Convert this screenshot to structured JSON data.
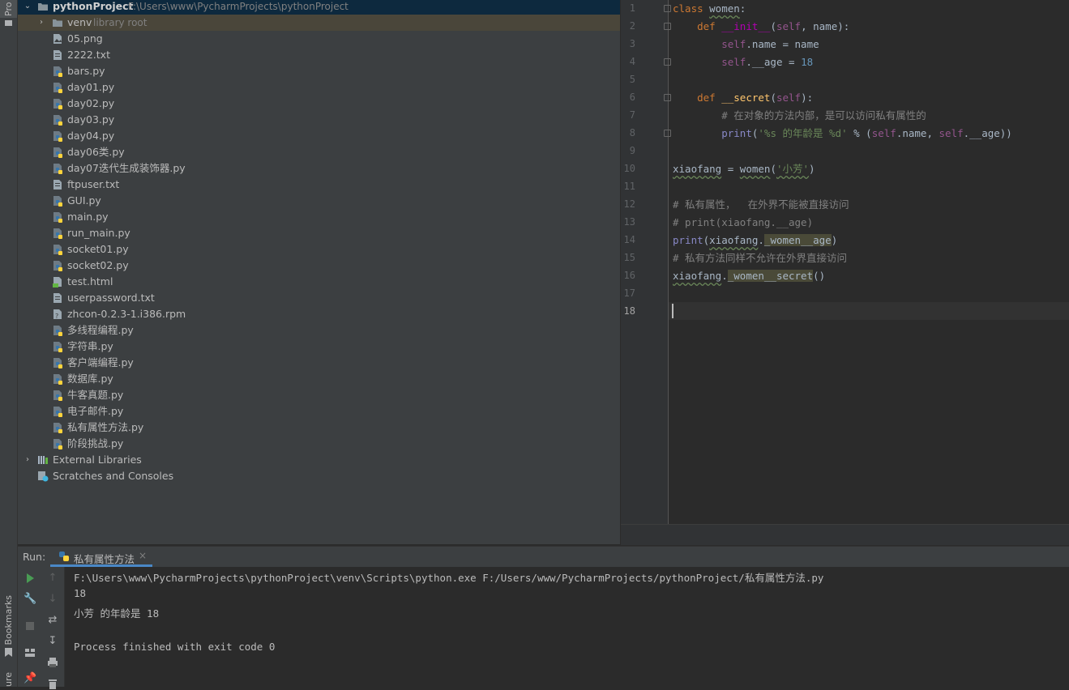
{
  "tool_stripe": {
    "project_tab": "Pro",
    "bookmarks_tab": "Bookmarks",
    "structure_tab": "ure"
  },
  "project": {
    "root_name": "pythonProject",
    "root_path": "F:\\Users\\www\\PycharmProjects\\pythonProject",
    "venv_name": "venv",
    "venv_hint": "library root",
    "files": [
      "05.png",
      "2222.txt",
      "bars.py",
      "day01.py",
      "day02.py",
      "day03.py",
      "day04.py",
      "day06类.py",
      "day07迭代生成装饰器.py",
      "ftpuser.txt",
      "GUI.py",
      "main.py",
      "run_main.py",
      "socket01.py",
      "socket02.py",
      "test.html",
      "userpassword.txt",
      "zhcon-0.2.3-1.i386.rpm",
      "多线程编程.py",
      "字符串.py",
      "客户端编程.py",
      "数据库.py",
      "牛客真题.py",
      "电子邮件.py",
      "私有属性方法.py",
      "阶段挑战.py"
    ],
    "file_types": [
      "image",
      "text",
      "python",
      "python",
      "python",
      "python",
      "python",
      "python",
      "python",
      "text",
      "python",
      "python",
      "python",
      "python",
      "python",
      "html",
      "text",
      "unknown",
      "python",
      "python",
      "python",
      "python",
      "python",
      "python",
      "python",
      "python"
    ],
    "external_libraries": "External Libraries",
    "scratches": "Scratches and Consoles"
  },
  "editor": {
    "line_numbers": [
      "1",
      "2",
      "3",
      "4",
      "5",
      "6",
      "7",
      "8",
      "9",
      "10",
      "11",
      "12",
      "13",
      "14",
      "15",
      "16",
      "17",
      "18"
    ],
    "current_line": "18",
    "comment_1": "# 在对象的方法内部，是可以访问私有属性的",
    "print_format": "'%s 的年龄是 %d'",
    "string_arg": "'小芳'",
    "comment_12": "# 私有属性，  在外界不能被直接访问",
    "comment_13": "# print(xiaofang.__age)",
    "comment_15": "# 私有方法同样不允许在外界直接访问"
  },
  "run": {
    "label": "Run:",
    "tab": "私有属性方法",
    "console": [
      "F:\\Users\\www\\PycharmProjects\\pythonProject\\venv\\Scripts\\python.exe F:/Users/www/PycharmProjects/pythonProject/私有属性方法.py",
      "18",
      "小芳 的年龄是 18",
      "",
      "Process finished with exit code 0"
    ]
  },
  "colors": {
    "panel_bg": "#3c3f41",
    "editor_bg": "#2b2b2b",
    "selection": "#0d293e",
    "keyword": "#cc7832",
    "function": "#ffc66d",
    "self": "#94558d",
    "string": "#6a8759",
    "number": "#6897bb",
    "comment": "#808080",
    "run_green": "#499c54"
  }
}
